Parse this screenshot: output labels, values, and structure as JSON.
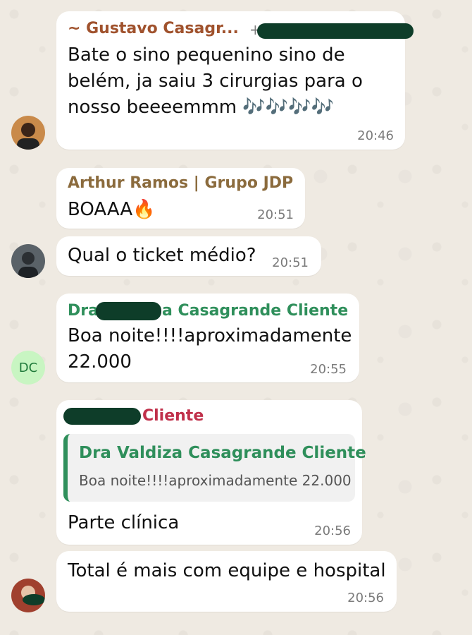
{
  "colors": {
    "background": "#efeae2",
    "bubble": "#ffffff",
    "sender_gustavo": "#a0522d",
    "sender_arthur": "#8b6b3d",
    "sender_dra": "#2f8f5b",
    "sender_cliente": "#c0304a",
    "redaction": "#0e3d29"
  },
  "icons": {
    "emoji_notes": "🎶",
    "emoji_fire": "🔥"
  },
  "messages": [
    {
      "sender": "~ Gustavo Casagr...",
      "phone_prefix": "+",
      "text": "Bate o sino pequenino sino de\nbelém, ja saiu 3 cirurgias para o\nnosso beeeemmm 🎶🎶🎶🎶",
      "time": "20:46"
    },
    {
      "sender": "Arthur Ramos | Grupo JDP",
      "text": "BOAAA🔥",
      "time": "20:51"
    },
    {
      "text": "Qual o ticket médio?",
      "time": "20:51"
    },
    {
      "sender_prefix": "Dra",
      "sender_suffix": "a Casagrande Cliente",
      "avatar_initials": "DC",
      "text": "Boa noite!!!!aproximadamente\n22.000",
      "time": "20:55"
    },
    {
      "sender_suffix": "Cliente",
      "quote": {
        "sender": "Dra Valdiza Casagrande Cliente",
        "text": "Boa noite!!!!aproximadamente 22.000"
      },
      "text": "Parte clínica",
      "time": "20:56"
    },
    {
      "text": "Total é mais com equipe e hospital",
      "time": "20:56"
    }
  ]
}
